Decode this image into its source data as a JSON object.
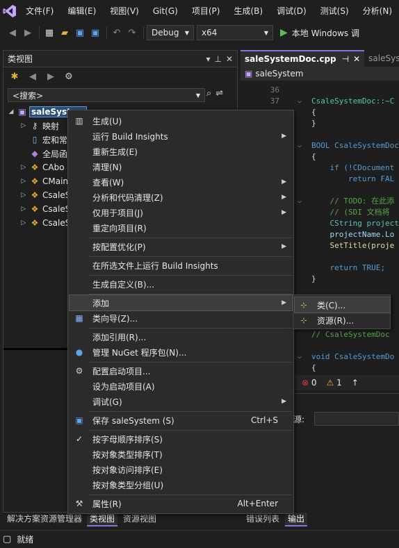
{
  "menubar": {
    "items": [
      "文件(F)",
      "编辑(E)",
      "视图(V)",
      "Git(G)",
      "项目(P)",
      "生成(B)",
      "调试(D)",
      "测试(S)",
      "分析(N)"
    ]
  },
  "toolbar": {
    "config": "Debug",
    "platform": "x64",
    "run_label": "本地 Windows 调"
  },
  "classview": {
    "title": "类视图",
    "search_placeholder": "<搜索>",
    "tree": {
      "root": "saleSystem",
      "children": [
        "映射",
        "宏和常",
        "全局函",
        "CAbo",
        "CMain",
        "CsaleS",
        "CsaleS",
        "CsaleS"
      ]
    }
  },
  "editor": {
    "tabs": [
      "saleSystemDoc.cpp",
      "saleSyste"
    ],
    "nav_scope": "saleSystem",
    "lines": [
      {
        "num": "36",
        "text": ""
      },
      {
        "num": "37",
        "text": "CsaleSystemDoc::~C"
      },
      {
        "num": "",
        "text": "{"
      },
      {
        "num": "",
        "text": "}"
      },
      {
        "num": "",
        "text": ""
      },
      {
        "num": "",
        "text": "BOOL CsaleSystemDoc"
      },
      {
        "num": "",
        "text": "{"
      },
      {
        "num": "",
        "text": "    if (!CDocument"
      },
      {
        "num": "",
        "text": "        return FAL"
      },
      {
        "num": "",
        "text": ""
      },
      {
        "num": "",
        "text": "    // TODO: 在此添"
      },
      {
        "num": "",
        "text": "    // (SDI 文档将"
      },
      {
        "num": "",
        "text": "    CString project"
      },
      {
        "num": "",
        "text": "    projectName.Lo"
      },
      {
        "num": "",
        "text": "    SetTitle(proje"
      },
      {
        "num": "",
        "text": ""
      },
      {
        "num": "",
        "text": "    return TRUE;"
      },
      {
        "num": "",
        "text": "}"
      }
    ],
    "lower_lines": [
      "// CsaleSystemDoc",
      "void CsaleSystemDo",
      "{"
    ],
    "errors": "0",
    "warnings": "1"
  },
  "output": {
    "source_label": "源:"
  },
  "bottom_tabs": [
    "解决方案资源管理器",
    "类视图",
    "资源视图",
    "错误列表",
    "输出"
  ],
  "status": {
    "text": "就绪"
  },
  "context_menu": {
    "items": [
      {
        "label": "生成(U)"
      },
      {
        "label": "运行 Build Insights"
      },
      {
        "label": "重新生成(E)"
      },
      {
        "label": "清理(N)"
      },
      {
        "label": "查看(W)"
      },
      {
        "label": "分析和代码清理(Z)"
      },
      {
        "label": "仅用于项目(J)"
      },
      {
        "label": "重定向项目(R)"
      },
      {
        "label": "按配置优化(P)"
      },
      {
        "label": "在所选文件上运行 Build Insights"
      },
      {
        "label": "生成自定义(B)..."
      },
      {
        "label": "添加"
      },
      {
        "label": "类向导(Z)..."
      },
      {
        "label": "添加引用(R)..."
      },
      {
        "label": "管理 NuGet 程序包(N)..."
      },
      {
        "label": "配置启动项目..."
      },
      {
        "label": "设为启动项目(A)"
      },
      {
        "label": "调试(G)"
      },
      {
        "label": "保存 saleSystem (S)",
        "shortcut": "Ctrl+S"
      },
      {
        "label": "按字母顺序排序(S)"
      },
      {
        "label": "按对象类型排序(T)"
      },
      {
        "label": "按对象访问排序(E)"
      },
      {
        "label": "按对象类型分组(U)"
      },
      {
        "label": "属性(R)",
        "shortcut": "Alt+Enter"
      }
    ]
  },
  "submenu": {
    "items": [
      "类(C)...",
      "资源(R)..."
    ]
  },
  "colors": {
    "accent": "#8f6fd8",
    "selection": "#264f78",
    "menu_bg": "#2b2b2b"
  }
}
